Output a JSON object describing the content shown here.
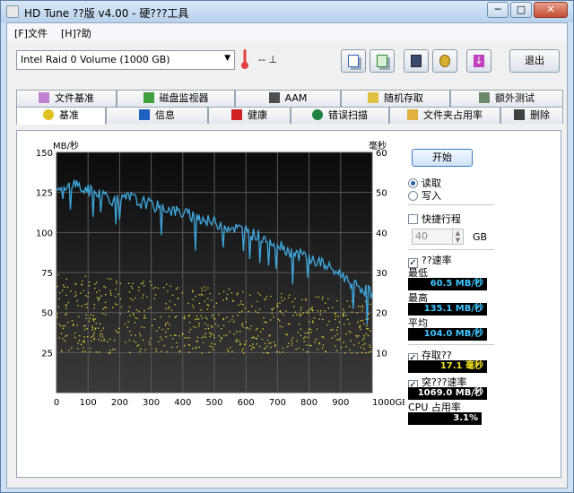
{
  "window": {
    "title": "HD Tune ??版 v4.00 - 硬???工具",
    "min": "─",
    "max": "□",
    "close": "✕"
  },
  "menu": {
    "file": "[F]文件",
    "help": "[H]?助"
  },
  "toolbar": {
    "drive": "Intel   Raid 0 Volume (1000 GB)",
    "temp": "-- ⊥",
    "exit_label": "退出",
    "icons": [
      "copy-text-icon",
      "copy-screenshot-icon",
      "save-icon",
      "options-icon",
      "download-icon"
    ]
  },
  "tabs_top": [
    "文件基准",
    "磁盘监视器",
    "AAM",
    "随机存取",
    "额外测试"
  ],
  "tabs_bottom": [
    "基准",
    "信息",
    "健康",
    "错误扫描",
    "文件夹占用率",
    "删除"
  ],
  "controls": {
    "start_label": "开始",
    "read": "读取",
    "write": "写入",
    "short_stroke": "快捷行程",
    "short_stroke_value": "40",
    "gb": "GB",
    "transfer_rate": "??速率",
    "min_label": "最低",
    "min_value": "60.5 MB/秒",
    "max_label": "最高",
    "max_value": "135.1 MB/秒",
    "avg_label": "平均",
    "avg_value": "104.0 MB/秒",
    "access_label": "存取??",
    "access_value": "17.1 毫秒",
    "burst_label": "突???速率",
    "burst_value": "1069.0 MB/秒",
    "cpu_label": "CPU 占用率",
    "cpu_value": "3.1%"
  },
  "chart_data": {
    "type": "line",
    "ylabel_left": "MB/秒",
    "ylabel_right": "毫秒",
    "xlim": [
      0,
      1000
    ],
    "ylim_left": [
      0,
      150
    ],
    "ylim_right": [
      0,
      60
    ],
    "x_ticks": [
      "0",
      "100",
      "200",
      "300",
      "400",
      "500",
      "600",
      "700",
      "800",
      "900",
      "1000GB"
    ],
    "y_ticks_left": [
      "25",
      "50",
      "75",
      "100",
      "125",
      "150"
    ],
    "y_ticks_right": [
      "10",
      "20",
      "30",
      "40",
      "50",
      "60"
    ],
    "grid": true,
    "series": [
      {
        "axis": "left",
        "color": "#3fa9e0",
        "x": [
          0,
          20,
          40,
          60,
          80,
          100,
          120,
          140,
          160,
          180,
          200,
          220,
          240,
          260,
          280,
          300,
          320,
          340,
          360,
          380,
          400,
          420,
          440,
          460,
          480,
          500,
          520,
          540,
          560,
          580,
          600,
          620,
          640,
          660,
          680,
          700,
          720,
          740,
          760,
          780,
          800,
          820,
          840,
          860,
          880,
          900,
          920,
          940,
          960,
          980,
          1000
        ],
        "y": [
          128,
          124,
          129,
          131,
          127,
          126,
          125,
          124,
          123,
          120,
          119,
          121,
          122,
          118,
          119,
          117,
          116,
          116,
          114,
          113,
          112,
          111,
          110,
          109,
          107,
          106,
          105,
          104,
          103,
          102,
          101,
          99,
          98,
          96,
          95,
          93,
          91,
          88,
          86,
          86,
          84,
          82,
          81,
          78,
          76,
          74,
          71,
          68,
          66,
          64,
          62
        ]
      },
      {
        "axis": "right",
        "type": "scatter",
        "color": "#e8e030",
        "note_range": [
          10,
          30
        ]
      }
    ]
  }
}
